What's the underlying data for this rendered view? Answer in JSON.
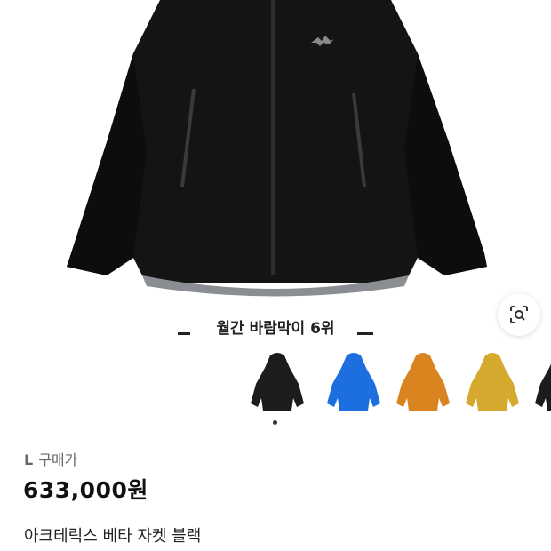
{
  "product": {
    "size": "L",
    "purchase_label": "구매가",
    "price": "633,000원",
    "title": "아크테릭스 베타 자켓 블랙"
  },
  "ranking": {
    "text": "월간 바람막이 6위"
  },
  "thumbnails": [
    {
      "color_name": "black",
      "color": "#1c1c1c"
    },
    {
      "color_name": "blue",
      "color": "#1d6fe0"
    },
    {
      "color_name": "orange",
      "color": "#d9841f"
    },
    {
      "color_name": "yellow",
      "color": "#d4a92e"
    },
    {
      "color_name": "black-partial",
      "color": "#1c1c1c"
    }
  ],
  "icons": {
    "lens": "lens-search-icon"
  }
}
